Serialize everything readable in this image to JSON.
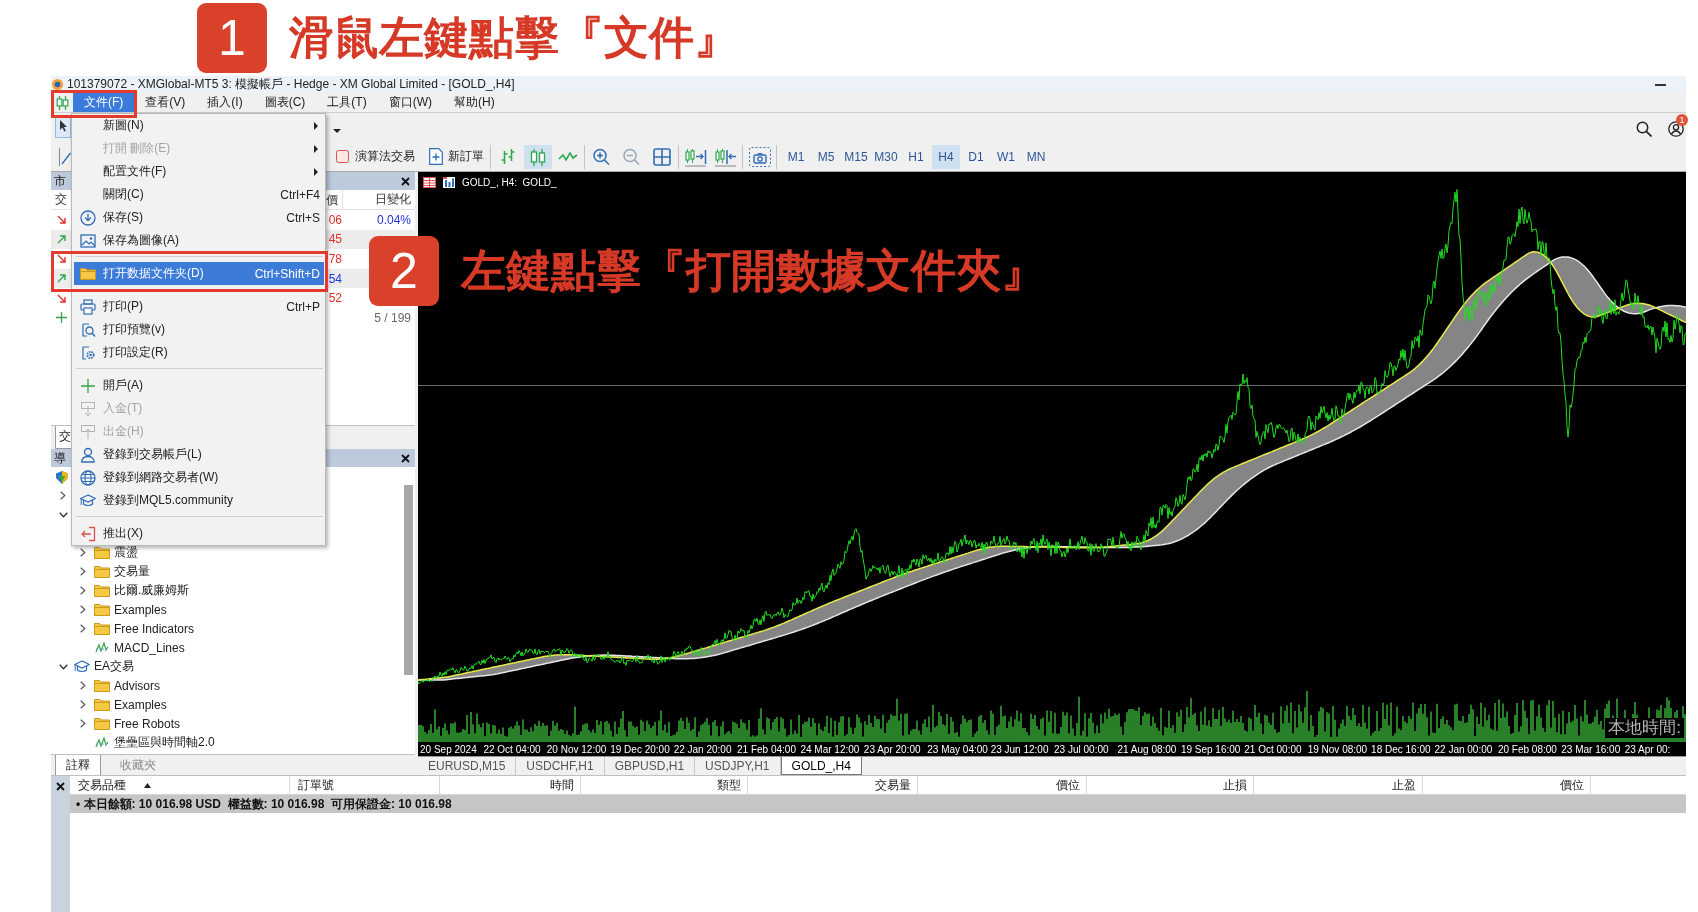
{
  "annotations": [
    {
      "number": "1",
      "text": "滑鼠左鍵點擊『文件』"
    },
    {
      "number": "2",
      "text": "左鍵點擊『打開數據文件夾』"
    }
  ],
  "window": {
    "title": "101379072 - XMGlobal-MT5 3: 模擬帳戶 - Hedge - XM Global Limited - [GOLD_,H4]"
  },
  "menu_bar": {
    "items": [
      {
        "label": "文件(F)",
        "selected": true
      },
      {
        "label": "查看(V)",
        "selected": false
      },
      {
        "label": "插入(I)",
        "selected": false
      },
      {
        "label": "圖表(C)",
        "selected": false
      },
      {
        "label": "工具(T)",
        "selected": false
      },
      {
        "label": "窗口(W)",
        "selected": false
      },
      {
        "label": "幫助(H)",
        "selected": false
      }
    ]
  },
  "file_menu": {
    "items": [
      {
        "kind": "item",
        "label": "新圖(N)",
        "submenu": true,
        "disabled": false,
        "selected": false
      },
      {
        "kind": "item",
        "label": "打開 刪除(E)",
        "submenu": true,
        "disabled": true,
        "selected": false
      },
      {
        "kind": "item",
        "label": "配置文件(F)",
        "submenu": true,
        "disabled": false,
        "selected": false
      },
      {
        "kind": "item",
        "label": "關閉(C)",
        "shortcut": "Ctrl+F4",
        "submenu": false,
        "disabled": false,
        "selected": false
      },
      {
        "kind": "item",
        "label": "保存(S)",
        "shortcut": "Ctrl+S",
        "submenu": false,
        "disabled": false,
        "selected": false
      },
      {
        "kind": "item",
        "label": "保存為圖像(A)",
        "submenu": false,
        "disabled": false,
        "selected": false
      },
      {
        "kind": "separator"
      },
      {
        "kind": "item",
        "label": "打开数据文件夹(D)",
        "shortcut": "Ctrl+Shift+D",
        "submenu": false,
        "disabled": false,
        "selected": true
      },
      {
        "kind": "separator"
      },
      {
        "kind": "item",
        "label": "打印(P)",
        "shortcut": "Ctrl+P",
        "submenu": false,
        "disabled": false,
        "selected": false
      },
      {
        "kind": "item",
        "label": "打印預覽(v)",
        "submenu": false,
        "disabled": false,
        "selected": false
      },
      {
        "kind": "item",
        "label": "打印設定(R)",
        "submenu": false,
        "disabled": false,
        "selected": false
      },
      {
        "kind": "separator"
      },
      {
        "kind": "item",
        "label": "開戶(A)",
        "submenu": false,
        "disabled": false,
        "selected": false
      },
      {
        "kind": "item",
        "label": "入金(T)",
        "submenu": false,
        "disabled": true,
        "selected": false
      },
      {
        "kind": "item",
        "label": "出金(H)",
        "submenu": false,
        "disabled": true,
        "selected": false
      },
      {
        "kind": "item",
        "label": "登錄到交易帳戶(L)",
        "submenu": false,
        "disabled": false,
        "selected": false
      },
      {
        "kind": "item",
        "label": "登錄到網路交易者(W)",
        "submenu": false,
        "disabled": false,
        "selected": false
      },
      {
        "kind": "item",
        "label": "登錄到MQL5.community",
        "submenu": false,
        "disabled": false,
        "selected": false
      },
      {
        "kind": "separator"
      },
      {
        "kind": "item",
        "label": "推出(X)",
        "submenu": false,
        "disabled": false,
        "selected": false
      }
    ]
  },
  "toolbar": {
    "account_badge": "1",
    "algo_trading": {
      "label": "演算法交易",
      "checked": false
    },
    "new_order": {
      "label": "新訂單"
    },
    "chart_types": [
      {
        "selected": false
      },
      {
        "selected": true
      },
      {
        "selected": false
      }
    ],
    "timeframes": [
      {
        "label": "M1",
        "selected": false
      },
      {
        "label": "M5",
        "selected": false
      },
      {
        "label": "M15",
        "selected": false
      },
      {
        "label": "M30",
        "selected": false
      },
      {
        "label": "H1",
        "selected": false
      },
      {
        "label": "H4",
        "selected": true
      },
      {
        "label": "D1",
        "selected": false
      },
      {
        "label": "W1",
        "selected": false
      },
      {
        "label": "MN",
        "selected": false
      }
    ]
  },
  "market_watch": {
    "title": "市",
    "columns": [
      "交",
      "價",
      "日變化"
    ],
    "rows": [
      {
        "trend_up": false,
        "bid_up": false,
        "bid": "06",
        "change": "0.04%"
      },
      {
        "trend_up": true,
        "bid_up": false,
        "bid": "45"
      },
      {
        "trend_up": false,
        "bid_up": false,
        "bid": "78"
      },
      {
        "trend_up": true,
        "bid_up": true,
        "bid": "54"
      },
      {
        "trend_up": false,
        "bid_up": false,
        "bid": "52"
      }
    ],
    "count": "5 / 199",
    "tabs": [
      {
        "label": "交",
        "selected": true
      }
    ]
  },
  "navigator": {
    "title": "導",
    "tree": [
      {
        "expanded": false
      },
      {
        "expanded": true,
        "children": [
          {
            "label": "震盪",
            "kind": "folder",
            "expanded": false
          },
          {
            "label": "交易量",
            "kind": "folder",
            "expanded": false
          },
          {
            "label": "比爾.威廉姆斯",
            "kind": "folder",
            "expanded": false
          },
          {
            "label": "Examples",
            "kind": "folder",
            "expanded": false
          },
          {
            "label": "Free Indicators",
            "kind": "folder",
            "expanded": false
          },
          {
            "label": "MACD_Lines",
            "kind": "file"
          }
        ]
      },
      {
        "label": "EA交易",
        "kind": "category",
        "expanded": true,
        "children": [
          {
            "label": "Advisors",
            "kind": "folder",
            "expanded": false
          },
          {
            "label": "Examples",
            "kind": "folder",
            "expanded": false
          },
          {
            "label": "Free Robots",
            "kind": "folder",
            "expanded": false
          },
          {
            "label": "堡壘區與時間軸2.0",
            "kind": "file"
          }
        ]
      }
    ],
    "tabs": [
      {
        "label": "註釋",
        "selected": true
      },
      {
        "label": "收藏夾",
        "selected": false
      }
    ]
  },
  "chart": {
    "caption": "GOLD_, H4:  GOLD_",
    "overlay_text": "本地時間:",
    "time_labels": [
      "20 Sep 2024",
      "22 Oct 04:00",
      "20 Nov 12:00",
      "19 Dec 20:00",
      "22 Jan 20:00",
      "21 Feb 04:00",
      "24 Mar 12:00",
      "23 Apr 20:00",
      "23 May 04:00",
      "23 Jun 12:00",
      "23 Jul 00:00",
      "21 Aug 08:00",
      "19 Sep 16:00",
      "21 Oct 00:00",
      "19 Nov 08:00",
      "18 Dec 16:00",
      "22 Jan 00:00",
      "20 Feb 08:00",
      "23 Mar 16:00",
      "23 Apr 00:"
    ],
    "tabs": [
      {
        "label": "EURUSD,M15",
        "selected": false
      },
      {
        "label": "USDCHF,H1",
        "selected": false
      },
      {
        "label": "GBPUSD,H1",
        "selected": false
      },
      {
        "label": "USDJPY,H1",
        "selected": false
      },
      {
        "label": "GOLD_,H4",
        "selected": true
      }
    ]
  },
  "toolbox": {
    "columns": [
      {
        "label": "交易品種",
        "sorted": true
      },
      {
        "label": "訂單號",
        "sorted": false
      },
      {
        "label": "時間",
        "sorted": false
      },
      {
        "label": "類型",
        "sorted": false
      },
      {
        "label": "交易量",
        "sorted": false
      },
      {
        "label": "價位",
        "sorted": false
      },
      {
        "label": "止損",
        "sorted": false
      },
      {
        "label": "止盈",
        "sorted": false
      },
      {
        "label": "價位",
        "sorted": false
      }
    ],
    "summary": "• 本日餘額: 10 016.98 USD  權益數: 10 016.98  可用保證金: 10 016.98"
  }
}
